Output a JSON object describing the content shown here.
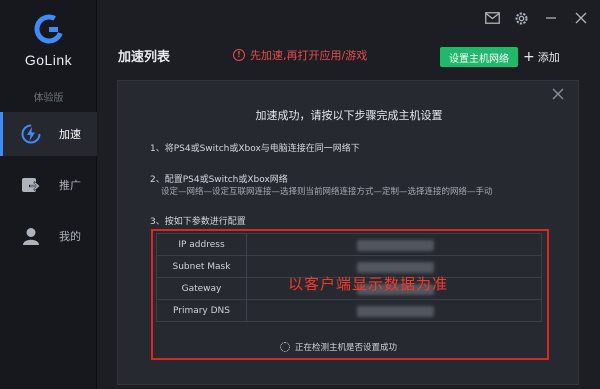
{
  "app": {
    "brand": "GoLink",
    "edition": "体验版"
  },
  "sidebar": {
    "items": [
      {
        "label": "加速",
        "icon": "lightning-icon",
        "active": true
      },
      {
        "label": "推广",
        "icon": "share-icon",
        "active": false
      },
      {
        "label": "我的",
        "icon": "user-icon",
        "active": false
      }
    ]
  },
  "topbar": {
    "icons": [
      "mail-icon",
      "settings-icon",
      "minimize-icon",
      "close-icon"
    ]
  },
  "header": {
    "title": "加速列表",
    "warning": "先加速,再打开应用/游戏",
    "config_button": "设置主机网络",
    "add_button": "添加"
  },
  "panel": {
    "heading": "加速成功，请按以下步骤完成主机设置",
    "step1": "1、将PS4或Switch或Xbox与电脑连接在同一网络下",
    "step2": "2、配置PS4或Switch或Xbox网络",
    "step2_detail": "设定—网络—设定互联网连接—选择则当前网络连接方式—定制—选择连接的网络—手动",
    "step3": "3、按如下参数进行配置",
    "params": [
      {
        "key": "IP address"
      },
      {
        "key": "Subnet Mask"
      },
      {
        "key": "Gateway"
      },
      {
        "key": "Primary DNS"
      }
    ],
    "overlay_note": "以客户端显示数据为准",
    "detect_status": "正在检测主机是否设置成功"
  },
  "colors": {
    "accent_blue": "#3e8cf7",
    "accent_green": "#20b96b",
    "warn_red": "#e84b4b",
    "annotation_red": "#e0241f"
  }
}
